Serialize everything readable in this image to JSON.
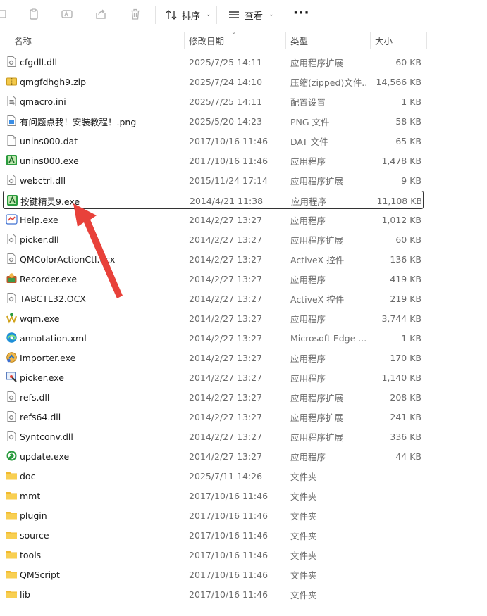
{
  "toolbar": {
    "sort_label": "排序",
    "view_label": "查看",
    "more_label": "···"
  },
  "columns": {
    "name": "名称",
    "date": "修改日期",
    "type": "类型",
    "size": "大小"
  },
  "files": [
    {
      "name": "cfgdll.dll",
      "date": "2025/7/25 14:11",
      "type": "应用程序扩展",
      "size": "60 KB",
      "icon": "dll-icon"
    },
    {
      "name": "qmgfdhgh9.zip",
      "date": "2025/7/24 14:10",
      "type": "压缩(zipped)文件...",
      "size": "14,566 KB",
      "icon": "zip-icon"
    },
    {
      "name": "qmacro.ini",
      "date": "2025/7/25 14:11",
      "type": "配置设置",
      "size": "1 KB",
      "icon": "ini-icon"
    },
    {
      "name": "有问题点我！安装教程！.png",
      "date": "2025/5/20 14:23",
      "type": "PNG 文件",
      "size": "58 KB",
      "icon": "png-icon"
    },
    {
      "name": "unins000.dat",
      "date": "2017/10/16 11:46",
      "type": "DAT 文件",
      "size": "65 KB",
      "icon": "file-icon"
    },
    {
      "name": "unins000.exe",
      "date": "2017/10/16 11:46",
      "type": "应用程序",
      "size": "1,478 KB",
      "icon": "app-green-icon"
    },
    {
      "name": "webctrl.dll",
      "date": "2015/11/24 17:14",
      "type": "应用程序扩展",
      "size": "9 KB",
      "icon": "dll-icon"
    },
    {
      "name": "按键精灵9.exe",
      "date": "2014/4/21 11:38",
      "type": "应用程序",
      "size": "11,108 KB",
      "icon": "app-green-icon",
      "selected": true
    },
    {
      "name": "Help.exe",
      "date": "2014/2/27 13:27",
      "type": "应用程序",
      "size": "1,012 KB",
      "icon": "help-icon"
    },
    {
      "name": "picker.dll",
      "date": "2014/2/27 13:27",
      "type": "应用程序扩展",
      "size": "60 KB",
      "icon": "dll-icon"
    },
    {
      "name": "QMColorActionCtl.ocx",
      "date": "2014/2/27 13:27",
      "type": "ActiveX 控件",
      "size": "136 KB",
      "icon": "dll-icon"
    },
    {
      "name": "Recorder.exe",
      "date": "2014/2/27 13:27",
      "type": "应用程序",
      "size": "419 KB",
      "icon": "recorder-icon"
    },
    {
      "name": "TABCTL32.OCX",
      "date": "2014/2/27 13:27",
      "type": "ActiveX 控件",
      "size": "219 KB",
      "icon": "dll-icon"
    },
    {
      "name": "wqm.exe",
      "date": "2014/2/27 13:27",
      "type": "应用程序",
      "size": "3,744 KB",
      "icon": "wqm-icon"
    },
    {
      "name": "annotation.xml",
      "date": "2014/2/27 13:27",
      "type": "Microsoft Edge ...",
      "size": "1 KB",
      "icon": "edge-icon"
    },
    {
      "name": "Importer.exe",
      "date": "2014/2/27 13:27",
      "type": "应用程序",
      "size": "170 KB",
      "icon": "importer-icon"
    },
    {
      "name": "picker.exe",
      "date": "2014/2/27 13:27",
      "type": "应用程序",
      "size": "1,140 KB",
      "icon": "picker-icon"
    },
    {
      "name": "refs.dll",
      "date": "2014/2/27 13:27",
      "type": "应用程序扩展",
      "size": "208 KB",
      "icon": "dll-icon"
    },
    {
      "name": "refs64.dll",
      "date": "2014/2/27 13:27",
      "type": "应用程序扩展",
      "size": "241 KB",
      "icon": "dll-icon"
    },
    {
      "name": "Syntconv.dll",
      "date": "2014/2/27 13:27",
      "type": "应用程序扩展",
      "size": "336 KB",
      "icon": "dll-icon"
    },
    {
      "name": "update.exe",
      "date": "2014/2/27 13:27",
      "type": "应用程序",
      "size": "44 KB",
      "icon": "update-icon"
    },
    {
      "name": "doc",
      "date": "2025/7/11 14:26",
      "type": "文件夹",
      "size": "",
      "icon": "folder-icon"
    },
    {
      "name": "mmt",
      "date": "2017/10/16 11:46",
      "type": "文件夹",
      "size": "",
      "icon": "folder-icon"
    },
    {
      "name": "plugin",
      "date": "2017/10/16 11:46",
      "type": "文件夹",
      "size": "",
      "icon": "folder-icon"
    },
    {
      "name": "source",
      "date": "2017/10/16 11:46",
      "type": "文件夹",
      "size": "",
      "icon": "folder-icon"
    },
    {
      "name": "tools",
      "date": "2017/10/16 11:46",
      "type": "文件夹",
      "size": "",
      "icon": "folder-icon"
    },
    {
      "name": "QMScript",
      "date": "2017/10/16 11:46",
      "type": "文件夹",
      "size": "",
      "icon": "folder-icon"
    },
    {
      "name": "lib",
      "date": "2017/10/16 11:46",
      "type": "文件夹",
      "size": "",
      "icon": "folder-icon"
    }
  ],
  "colors": {
    "annotation_arrow": "#e8413a",
    "folder": "#f6c342",
    "selection_border": "#333333"
  }
}
